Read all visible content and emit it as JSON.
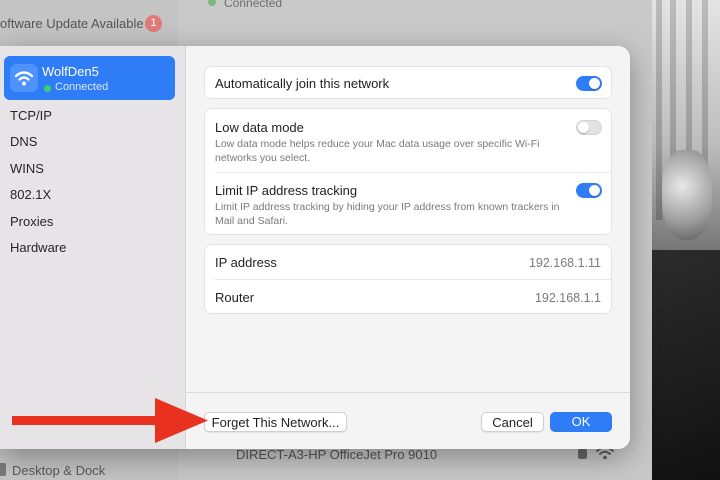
{
  "background": {
    "software_update_label": "oftware Update Available",
    "software_update_badge": "1",
    "connected_text": "Connected",
    "desktop_dock_label": "Desktop & Dock",
    "printer_network_label": "DIRECT-A3-HP OfficeJet Pro 9010"
  },
  "sidebar": {
    "network": {
      "name": "WolfDen5",
      "status": "Connected",
      "icon": "wifi-icon"
    },
    "items": [
      {
        "label": "TCP/IP"
      },
      {
        "label": "DNS"
      },
      {
        "label": "WINS"
      },
      {
        "label": "802.1X"
      },
      {
        "label": "Proxies"
      },
      {
        "label": "Hardware"
      }
    ]
  },
  "settings": {
    "auto_join": {
      "label": "Automatically join this network",
      "enabled": true
    },
    "low_data": {
      "label": "Low data mode",
      "description": "Low data mode helps reduce your Mac data usage over specific Wi-Fi networks you select.",
      "enabled": false
    },
    "limit_ip": {
      "label": "Limit IP address tracking",
      "description": "Limit IP address tracking by hiding your IP address from known trackers in Mail and Safari.",
      "enabled": true
    }
  },
  "info": {
    "ip_address": {
      "label": "IP address",
      "value": "192.168.1.11"
    },
    "router": {
      "label": "Router",
      "value": "192.168.1.1"
    }
  },
  "footer": {
    "forget_label": "Forget This Network...",
    "cancel_label": "Cancel",
    "ok_label": "OK"
  },
  "colors": {
    "accent": "#2e7cf6",
    "annotation_arrow": "#e8321f",
    "connected_dot": "#3bd16f",
    "badge": "#e07a78"
  }
}
